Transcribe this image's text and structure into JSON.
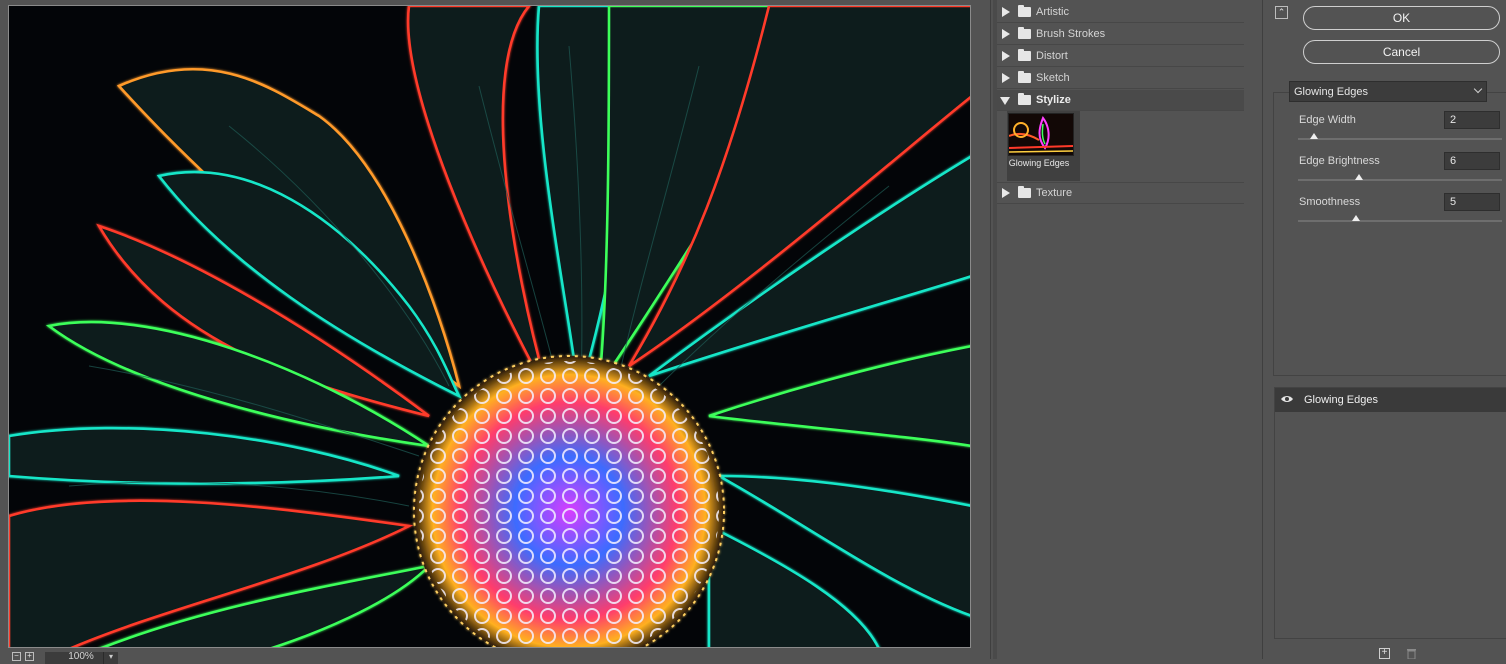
{
  "preview": {
    "zoom_value": "100%",
    "zoom_out_symbol": "−",
    "zoom_in_symbol": "+",
    "zoom_dropdown_symbol": "▾"
  },
  "gallery": {
    "categories": [
      {
        "label": "Artistic",
        "open": false
      },
      {
        "label": "Brush Strokes",
        "open": false
      },
      {
        "label": "Distort",
        "open": false
      },
      {
        "label": "Sketch",
        "open": false
      },
      {
        "label": "Stylize",
        "open": true
      },
      {
        "label": "Texture",
        "open": false
      }
    ],
    "stylize_thumbnails": [
      {
        "label": "Glowing Edges",
        "selected": true
      }
    ]
  },
  "panel": {
    "collapse_symbol": "⌃",
    "ok_label": "OK",
    "cancel_label": "Cancel",
    "selected_filter": "Glowing Edges",
    "params": [
      {
        "label": "Edge Width",
        "value": "2",
        "min": 1,
        "max": 14
      },
      {
        "label": "Edge Brightness",
        "value": "6",
        "min": 0,
        "max": 20
      },
      {
        "label": "Smoothness",
        "value": "5",
        "min": 1,
        "max": 15
      }
    ],
    "layer_label": "Glowing Edges",
    "add_symbol": "+"
  },
  "colors": {
    "background": "#535353",
    "preview_bg": "#030508",
    "selected_row": "#3a3a3a",
    "glow_cyan": "#19e6c8",
    "glow_red": "#ff3a2a",
    "glow_green": "#3cff5a"
  }
}
